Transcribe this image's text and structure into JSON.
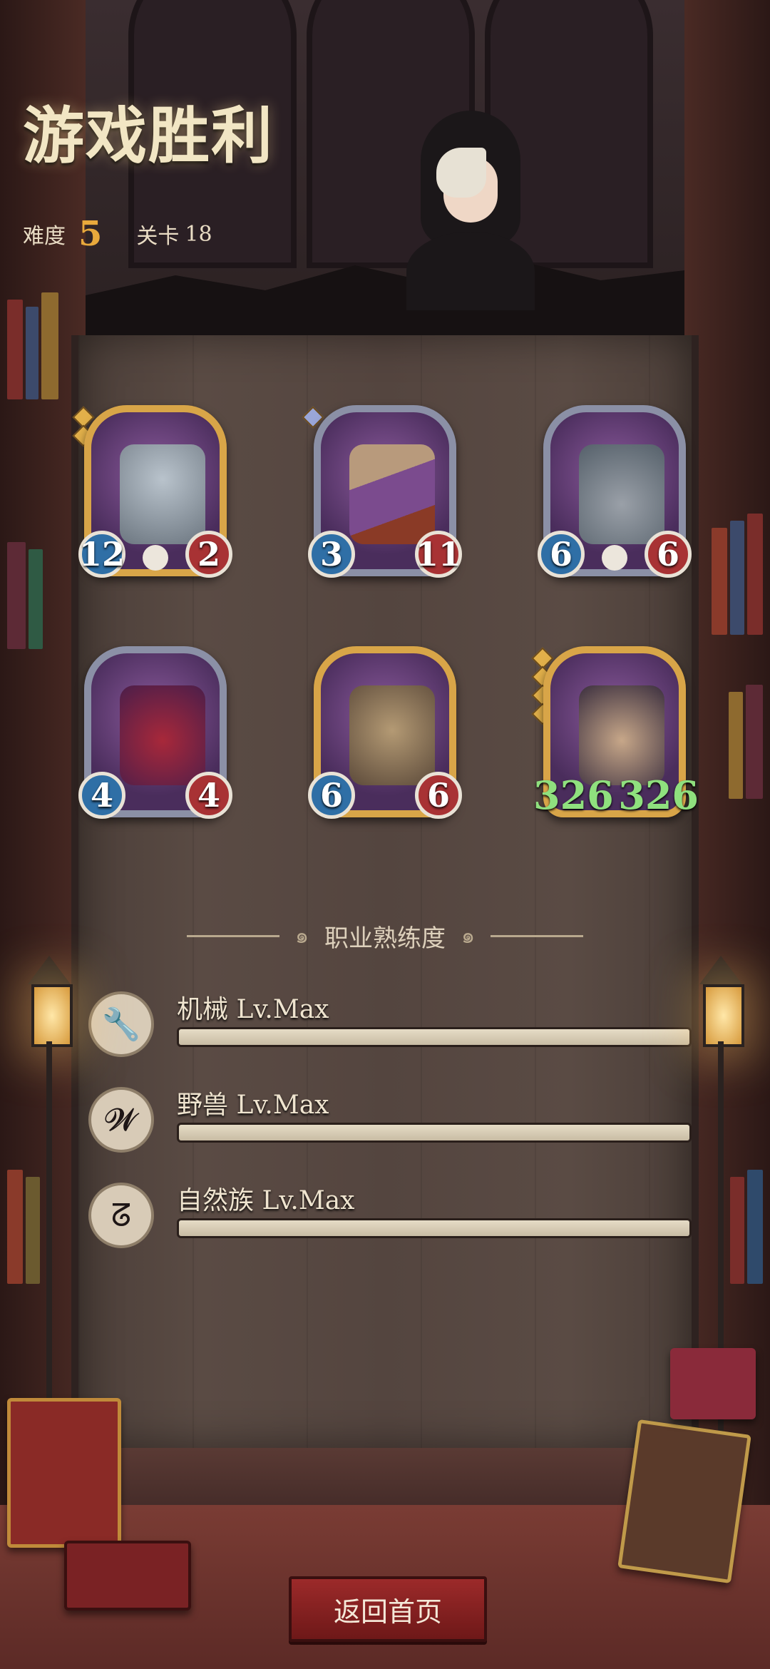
{
  "header": {
    "title": "游戏胜利",
    "difficulty_label": "难度",
    "difficulty_value": "5",
    "stage_label": "关卡",
    "stage_value": "18"
  },
  "cards": [
    {
      "name": "robot-drone-card",
      "attack": "12",
      "health": "2",
      "frame": "gold",
      "skull": true
    },
    {
      "name": "airship-card",
      "attack": "3",
      "health": "11",
      "frame": "silver",
      "skull": false
    },
    {
      "name": "bell-robot-card",
      "attack": "6",
      "health": "6",
      "frame": "silver",
      "skull": true
    },
    {
      "name": "clown-card",
      "attack": "4",
      "health": "4",
      "frame": "silver",
      "skull": false
    },
    {
      "name": "voodoo-doll-card",
      "attack": "6",
      "health": "6",
      "frame": "gold",
      "skull": false
    },
    {
      "name": "brute-card",
      "attack": "326",
      "health": "326",
      "frame": "gold",
      "skull": false,
      "buffed": true
    }
  ],
  "mastery": {
    "heading": "职业熟练度",
    "rows": [
      {
        "label": "机械 Lv.Max",
        "icon": "wrench-icon",
        "progress": 1.0
      },
      {
        "label": "野兽 Lv.Max",
        "icon": "claw-icon",
        "progress": 1.0
      },
      {
        "label": "自然族 Lv.Max",
        "icon": "leaf-spiral-icon",
        "progress": 1.0
      }
    ]
  },
  "actions": {
    "return_label": "返回首页"
  },
  "colors": {
    "attack": "#2f6fa6",
    "health": "#a83234",
    "buffed_stat": "#8fe07e",
    "difficulty": "#e8a93c",
    "button": "#9c2a2a"
  }
}
